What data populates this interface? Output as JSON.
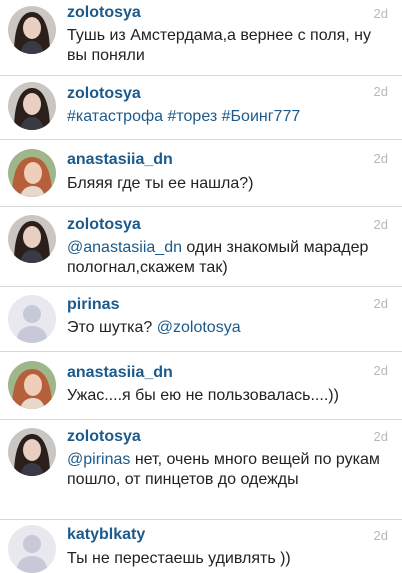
{
  "comments": [
    {
      "username": "zolotosya",
      "time": "2d",
      "avatar": "woman-dark-hair-photo",
      "text_parts": [
        {
          "t": "Тушь из Амстердама,а вернее с поля, ну вы поняли",
          "kind": "plain"
        }
      ]
    },
    {
      "username": "zolotosya",
      "time": "2d",
      "avatar": "woman-dark-hair-photo",
      "text_parts": [
        {
          "t": "#катастрофа #торез #Боинг777",
          "kind": "hashtag"
        }
      ]
    },
    {
      "username": "anastasiia_dn",
      "time": "2d",
      "avatar": "woman-red-hair-photo",
      "text_parts": [
        {
          "t": "Бляяя где ты ее нашла?)",
          "kind": "plain"
        }
      ]
    },
    {
      "username": "zolotosya",
      "time": "2d",
      "avatar": "woman-dark-hair-photo",
      "text_parts": [
        {
          "t": "@anastasiia_dn",
          "kind": "mention"
        },
        {
          "t": " один знакомый марадер пологнал,скажем так)",
          "kind": "plain"
        }
      ]
    },
    {
      "username": "pirinas",
      "time": "2d",
      "avatar": "default-user-icon",
      "text_parts": [
        {
          "t": "Это шутка? ",
          "kind": "plain"
        },
        {
          "t": "@zolotosya",
          "kind": "mention"
        }
      ]
    },
    {
      "username": "anastasiia_dn",
      "time": "2d",
      "avatar": "woman-red-hair-photo",
      "text_parts": [
        {
          "t": "Ужас....я бы ею не пользовалась....))",
          "kind": "plain"
        }
      ]
    },
    {
      "username": "zolotosya",
      "time": "2d",
      "avatar": "woman-dark-hair-photo",
      "text_parts": [
        {
          "t": "@pirinas",
          "kind": "mention"
        },
        {
          "t": " нет, очень много вещей по рукам пошло, от пинцетов до одежды",
          "kind": "plain"
        }
      ]
    },
    {
      "username": "katyblkaty",
      "time": "2d",
      "avatar": "default-user-icon",
      "text_parts": [
        {
          "t": "Ты не перестаешь удивлять ))",
          "kind": "plain"
        }
      ]
    }
  ],
  "colors": {
    "username": "#1c5a8c",
    "mention": "#1c5a8c",
    "text": "#222222",
    "time": "#b8b8b8",
    "divider": "#d9d9d9"
  }
}
